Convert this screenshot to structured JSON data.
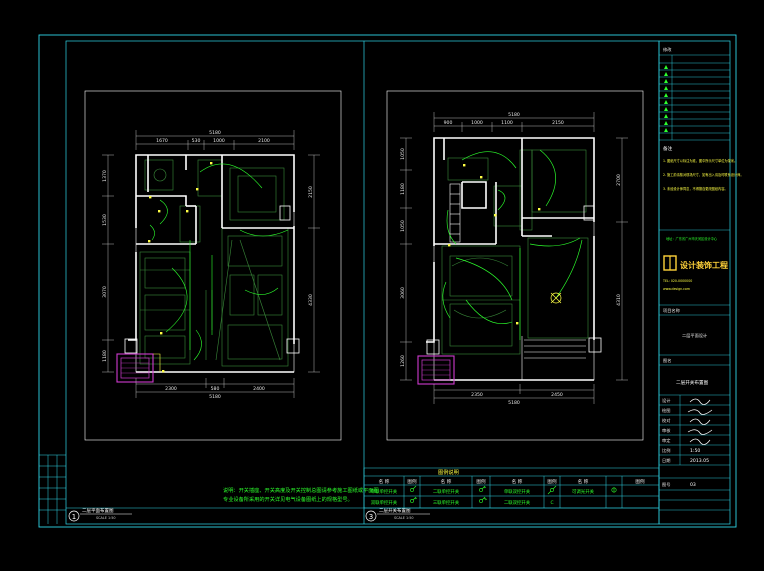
{
  "colors": {
    "frame": "#2fd6e8",
    "wall": "#ffffff",
    "furniture": "#3a8a3a",
    "wiring": "#2cff2c",
    "dim_line": "#c8c8c8",
    "sheet_border": "#ffffff",
    "yellow": "#ffff44",
    "magenta": "#d03ad0"
  },
  "plan_left": {
    "dims_top": [
      "5180",
      "1670",
      "530",
      "1000",
      "2100"
    ],
    "dims_bottom": [
      "2300",
      "580",
      "2400"
    ],
    "dims_bottom_total": "5180",
    "dims_left": [
      "1370",
      "1530",
      "3070",
      "1180"
    ],
    "dims_right": [
      "2150",
      "4330"
    ],
    "caption": "二层平面布置图",
    "caption_sub": "SCALE 1:50",
    "number": "1"
  },
  "plan_right": {
    "dims_top": [
      "5180",
      "900",
      "1000",
      "1100",
      "2150"
    ],
    "dims_bottom": [
      "2350",
      "2450"
    ],
    "dims_bottom_total": "5180",
    "dims_left": [
      "1050",
      "1180",
      "1050",
      "3060",
      "1260"
    ],
    "dims_right": [
      "2700",
      "4310"
    ],
    "caption": "二层开关布置图",
    "caption_sub": "SCALE 1:50",
    "number": "3"
  },
  "note": {
    "line1": "说明：开关插座、开关高度及开关控制总图请参考施工图纸或平面图",
    "line2": "专业设备所采用的开关详见电气设备图纸上的规格型号。"
  },
  "legend": {
    "title": "图例说明",
    "headers": [
      "名 称",
      "图例",
      "名 称",
      "图例",
      "名 称",
      "图例",
      "名 称",
      "图例"
    ],
    "row1": [
      "单联单控开关",
      "二联单控开关",
      "单联双控开关",
      "可调光开关"
    ],
    "row2": [
      "双联单控开关",
      "三联单控开关",
      "二联双控开关"
    ],
    "row2_extra": "C"
  },
  "title_block": {
    "notes_heading": "备注",
    "notes": [
      "1. 图纸尺寸以标注为准，图中所示尺寸单位为毫米。",
      "2. 施工前请核对现场尺寸，如有出入请及时联系设计师。",
      "3. 未经设计师同意，不得擅自更改图纸内容。"
    ],
    "company_address": "地址：广东省广州市天河区设计中心",
    "company_name": "设计装饰工程",
    "contact": "TEL: 020-0000000",
    "website": "www.design.com",
    "project_label": "项目名称",
    "project_value": "二层平面设计",
    "drawing_label": "图名",
    "drawing_value": "二层开关布置图",
    "rows": [
      {
        "label": "设计",
        "value": ""
      },
      {
        "label": "绘图",
        "value": ""
      },
      {
        "label": "校对",
        "value": ""
      },
      {
        "label": "审核",
        "value": ""
      },
      {
        "label": "审定",
        "value": ""
      }
    ],
    "scale_label": "比例",
    "scale_value": "1:50",
    "date_label": "日期",
    "date_value": "2013.05",
    "sheet_label": "图号",
    "sheet_value": "03",
    "revision_heading": "修改"
  }
}
